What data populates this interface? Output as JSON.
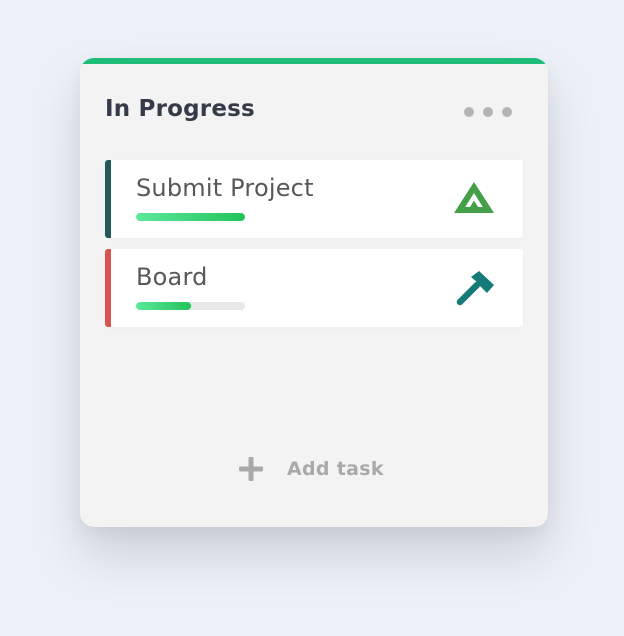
{
  "column": {
    "title": "In Progress",
    "accent_color": "#1fbe78",
    "menu_icon": "more-horizontal-icon",
    "tasks": [
      {
        "title": "Submit Project",
        "accent_color": "#22595a",
        "progress": 1.0,
        "icon": "mountain-icon",
        "icon_color": "#43a047"
      },
      {
        "title": "Board",
        "accent_color": "#d9534f",
        "progress": 0.5,
        "icon": "hammer-icon",
        "icon_color": "#147b78"
      }
    ],
    "add_task": {
      "label": "Add task",
      "icon": "plus-icon"
    }
  }
}
